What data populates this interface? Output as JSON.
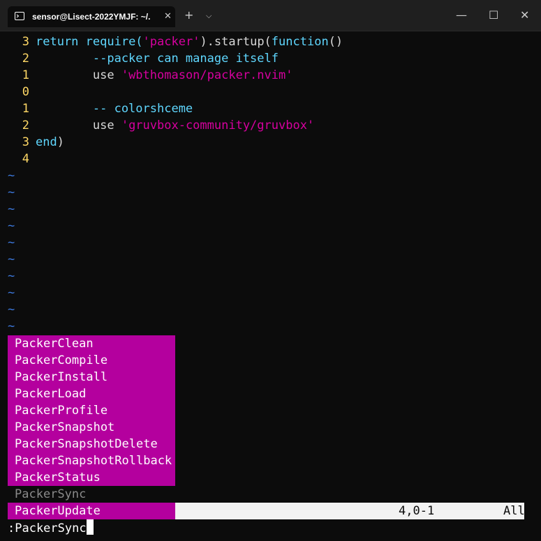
{
  "window": {
    "tab_title": "sensor@Lisect-2022YMJF: ~/.",
    "new_tab": "+",
    "dropdown": "⌵",
    "minimize": "—",
    "maximize": "☐",
    "close": "✕",
    "tab_close": "✕"
  },
  "editor": {
    "lines": [
      {
        "num": "3",
        "tokens": [
          {
            "t": "return ",
            "c": "kw"
          },
          {
            "t": "require(",
            "c": "kw"
          },
          {
            "t": "'packer'",
            "c": "str"
          },
          {
            "t": ").startup(",
            "c": ""
          },
          {
            "t": "function",
            "c": "kw"
          },
          {
            "t": "()",
            "c": ""
          }
        ]
      },
      {
        "num": "2",
        "tokens": [
          {
            "t": "        --packer can manage itself",
            "c": "cm"
          }
        ]
      },
      {
        "num": "1",
        "tokens": [
          {
            "t": "        use ",
            "c": ""
          },
          {
            "t": "'wbthomason/packer.nvim'",
            "c": "str"
          }
        ]
      },
      {
        "num": "0",
        "tokens": []
      },
      {
        "num": "1",
        "tokens": [
          {
            "t": "        -- colorshceme",
            "c": "cm"
          }
        ]
      },
      {
        "num": "2",
        "tokens": [
          {
            "t": "        use ",
            "c": ""
          },
          {
            "t": "'gruvbox-community/gruvbox'",
            "c": "str"
          }
        ]
      },
      {
        "num": "3",
        "tokens": [
          {
            "t": "end",
            "c": "kw"
          },
          {
            "t": ")",
            "c": ""
          }
        ]
      },
      {
        "num": "4",
        "tokens": []
      }
    ],
    "tilde": "~",
    "tilde_count": 10
  },
  "completion": {
    "items": [
      "PackerClean",
      "PackerCompile",
      "PackerInstall",
      "PackerLoad",
      "PackerProfile",
      "PackerSnapshot",
      "PackerSnapshotDelete",
      "PackerSnapshotRollback",
      "PackerStatus",
      "PackerSync"
    ],
    "selected_index": 9
  },
  "statusline": {
    "item": "PackerUpdate",
    "position": "4,0-1",
    "scroll": "All"
  },
  "cmdline": {
    "text": ":PackerSync"
  },
  "colors": {
    "popup_bg": "#b4009e",
    "line_number": "#ffd866",
    "keyword": "#5fd7ff",
    "string": "#d7009f",
    "tilde": "#3c78dc"
  }
}
